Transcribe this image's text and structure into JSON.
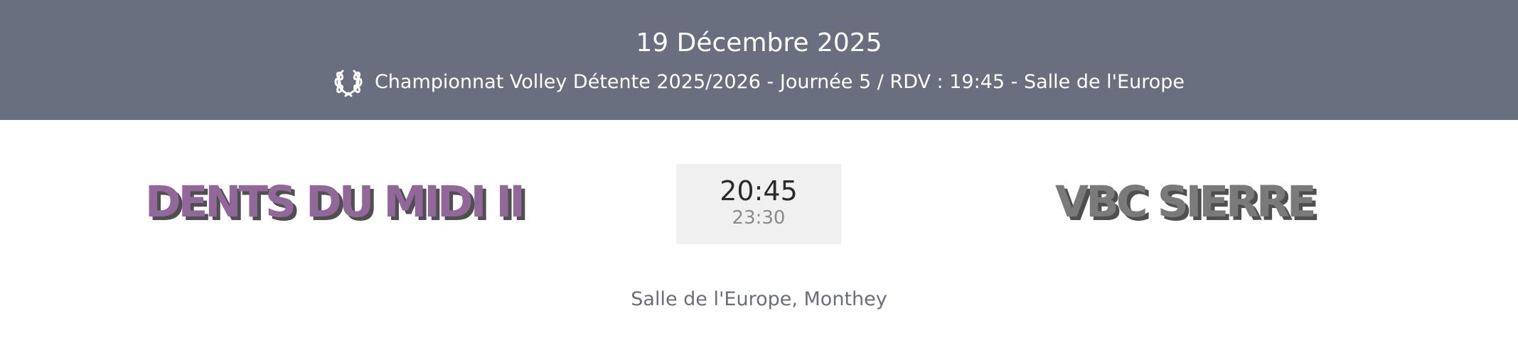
{
  "header": {
    "date": "19 Décembre 2025",
    "competition": "Championnat Volley Détente 2025/2026 - Journée 5 / RDV : 19:45 - Salle de l'Europe",
    "icon": "laurel-wreath-icon"
  },
  "match": {
    "home_team": "DENTS DU MIDI II",
    "away_team": "VBC SIERRE",
    "start_time": "20:45",
    "end_time": "23:30"
  },
  "venue": "Salle de l'Europe, Monthey",
  "colors": {
    "header_bg": "#696f7e",
    "home_team": "#92679a",
    "away_team": "#7a7a7a",
    "time_box_bg": "#f0f0f0",
    "venue_text": "#6a6e79"
  }
}
